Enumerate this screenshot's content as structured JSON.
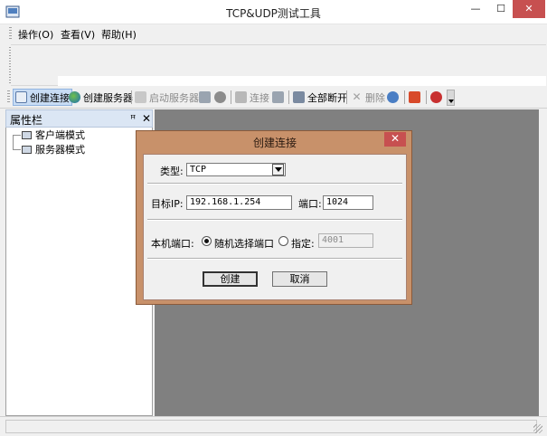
{
  "window": {
    "title": "TCP&UDP测试工具",
    "min": "—",
    "max": "☐",
    "close": "✕"
  },
  "menu": [
    "操作(O)",
    "查看(V)",
    "帮助(H)"
  ],
  "toolbar": {
    "create_connection": "创建连接",
    "create_server": "创建服务器",
    "start_server": "启动服务器",
    "connect": "连接",
    "disconnect_all": "全部断开",
    "delete": "删除"
  },
  "property_panel": {
    "title": "属性栏",
    "pin": "ꟸ",
    "close": "✕",
    "nodes": [
      "客户端模式",
      "服务器模式"
    ]
  },
  "dialog": {
    "title": "创建连接",
    "close": "✕",
    "type_label": "类型:",
    "type_value": "TCP",
    "target_ip_label": "目标IP:",
    "target_ip_value": "192.168.1.254",
    "port_label": "端口:",
    "port_value": "1024",
    "local_port_label": "本机端口:",
    "random_port_label": "随机选择端口",
    "specify_label": "指定:",
    "specify_value": "4001",
    "create_button": "创建",
    "cancel_button": "取消"
  },
  "colors": {
    "dialog_frame": "#c8916a",
    "workspace": "#808080",
    "window_close": "#c75050"
  }
}
